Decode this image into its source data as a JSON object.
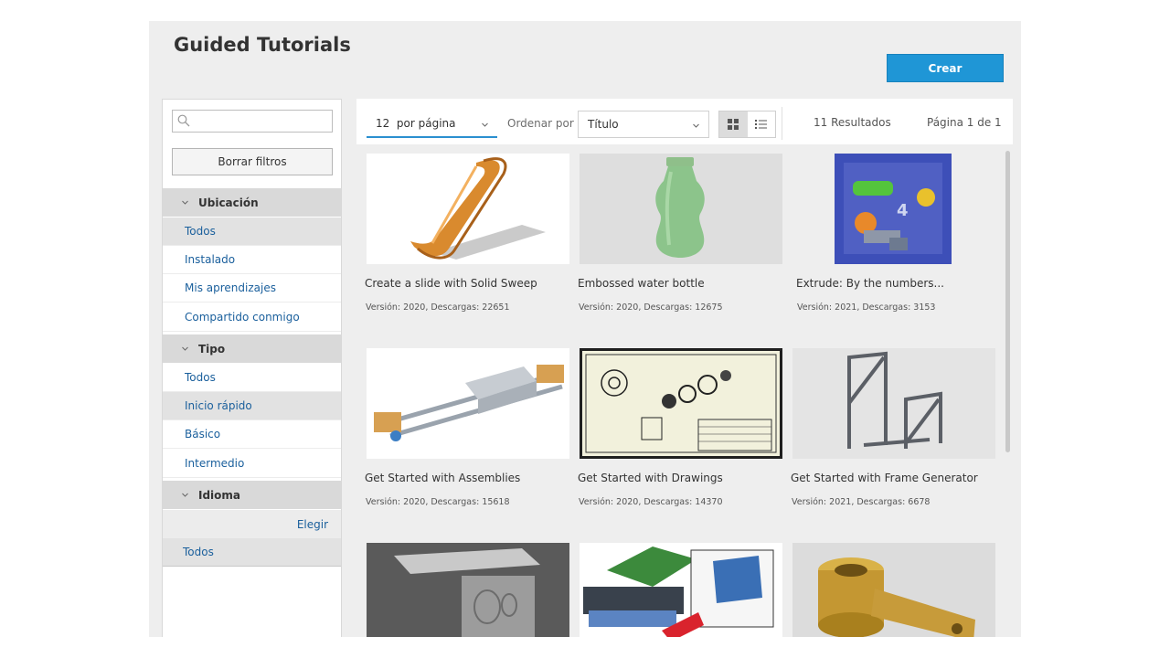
{
  "header": {
    "title": "Guided Tutorials",
    "create_label": "Crear"
  },
  "sidebar": {
    "search": {
      "placeholder": ""
    },
    "clear_filters_label": "Borrar filtros",
    "location": {
      "header": "Ubicación",
      "items": [
        "Todos",
        "Instalado",
        "Mis aprendizajes",
        "Compartido conmigo"
      ],
      "selected": "Todos"
    },
    "type": {
      "header": "Tipo",
      "items": [
        "Todos",
        "Inicio rápido",
        "Básico",
        "Intermedio"
      ],
      "selected": "Inicio rápido"
    },
    "language": {
      "header": "Idioma",
      "choose_label": "Elegir",
      "items": [
        "Todos"
      ],
      "selected": "Todos"
    }
  },
  "toolbar": {
    "per_page": "12  por página",
    "sort_label": "Ordenar por",
    "sort_value": "Título",
    "view_mode": "grid",
    "results": "11 Resultados",
    "page_info": "Página 1 de 1"
  },
  "tutorials": [
    {
      "title": "Create a slide with Solid Sweep",
      "meta": "Versión: 2020, Descargas: 22651"
    },
    {
      "title": "Embossed water bottle",
      "meta": "Versión: 2020, Descargas: 12675"
    },
    {
      "title": "Extrude: By the numbers...",
      "meta": "Versión: 2021, Descargas: 3153"
    },
    {
      "title": "Get Started with Assemblies",
      "meta": "Versión: 2020, Descargas: 15618"
    },
    {
      "title": "Get Started with Drawings",
      "meta": "Versión: 2020, Descargas: 14370"
    },
    {
      "title": "Get Started with Frame Generator",
      "meta": "Versión: 2021, Descargas: 6678"
    },
    {
      "title": "",
      "meta": ""
    },
    {
      "title": "",
      "meta": ""
    },
    {
      "title": "",
      "meta": ""
    }
  ],
  "colors": {
    "accent": "#1f96d6",
    "link": "#1a5f9c",
    "background": "#eeeeee"
  }
}
